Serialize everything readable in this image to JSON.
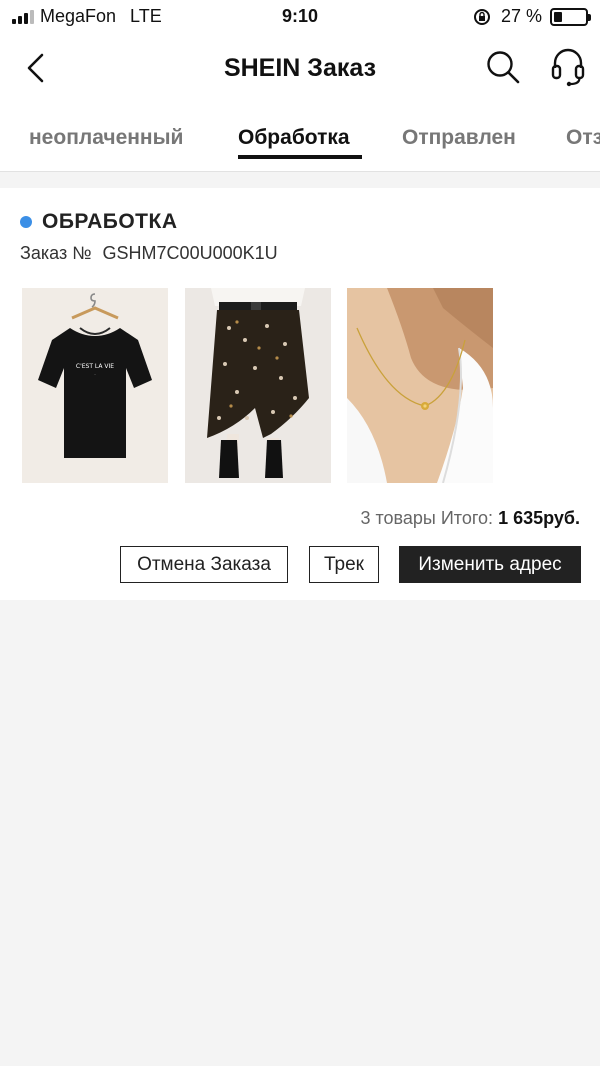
{
  "status_bar": {
    "carrier": "MegaFon",
    "network": "LTE",
    "time": "9:10",
    "battery_percent": "27 %",
    "battery_level": 0.27
  },
  "nav": {
    "title": "SHEIN Заказ",
    "back_icon": "chevron-left-icon",
    "search_icon": "search-icon",
    "support_icon": "headset-icon"
  },
  "tabs": [
    {
      "label": "неоплаченный",
      "active": false
    },
    {
      "label": "Обработка",
      "active": true
    },
    {
      "label": "Отправлен",
      "active": false
    },
    {
      "label": "Отз",
      "active": false
    }
  ],
  "order": {
    "status": "ОБРАБОТКА",
    "status_color": "#3b8fe6",
    "order_label": "Заказ №",
    "order_number": "GSHM7C00U000K1U",
    "products": [
      {
        "type": "black-tshirt-image",
        "print": "C'EST LA VIE"
      },
      {
        "type": "floral-skirt-image"
      },
      {
        "type": "gold-necklace-image"
      }
    ],
    "summary_prefix": "3 товары Итого:",
    "summary_total": "1 635руб.",
    "buttons": {
      "cancel": "Отмена Заказа",
      "track": "Трек",
      "change_address": "Изменить адрес"
    }
  }
}
